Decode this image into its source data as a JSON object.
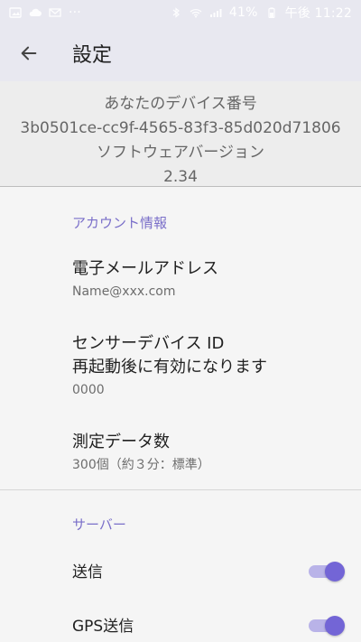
{
  "statusbar": {
    "left_icons": [
      "image-icon",
      "cloud-icon",
      "mail-icon",
      "more-icon"
    ],
    "more_text": "···",
    "battery_text": "41%",
    "time_text": "午後 11:22",
    "right_icons": [
      "bluetooth-icon",
      "wifi-icon",
      "signal-icon",
      "battery-icon"
    ]
  },
  "appbar": {
    "title": "設定",
    "back_icon": "arrow-left-icon"
  },
  "device_info": {
    "device_number_label": "あなたのデバイス番号",
    "device_id": "3b0501ce-cc9f-4565-83f3-85d020d71806",
    "software_version_label": "ソフトウェアバージョン",
    "software_version": "2.34"
  },
  "account": {
    "header": "アカウント情報",
    "email_title": "電子メールアドレス",
    "email_value": "Name@xxx.com",
    "sensor_title_line1": "センサーデバイス ID",
    "sensor_title_line2": "再起動後に有効になります",
    "sensor_value": "0000",
    "measure_title": "測定データ数",
    "measure_value": "300個（約３分：標準）"
  },
  "server": {
    "header": "サーバー",
    "send_label": "送信",
    "gps_send_label": "GPS送信",
    "send_enabled": true,
    "gps_send_enabled": true
  },
  "colors": {
    "accent": "#7365d6",
    "accent_track": "#b9b3e8",
    "section_header": "#7a6fc9",
    "appbar_bg": "#e8e8f0"
  }
}
